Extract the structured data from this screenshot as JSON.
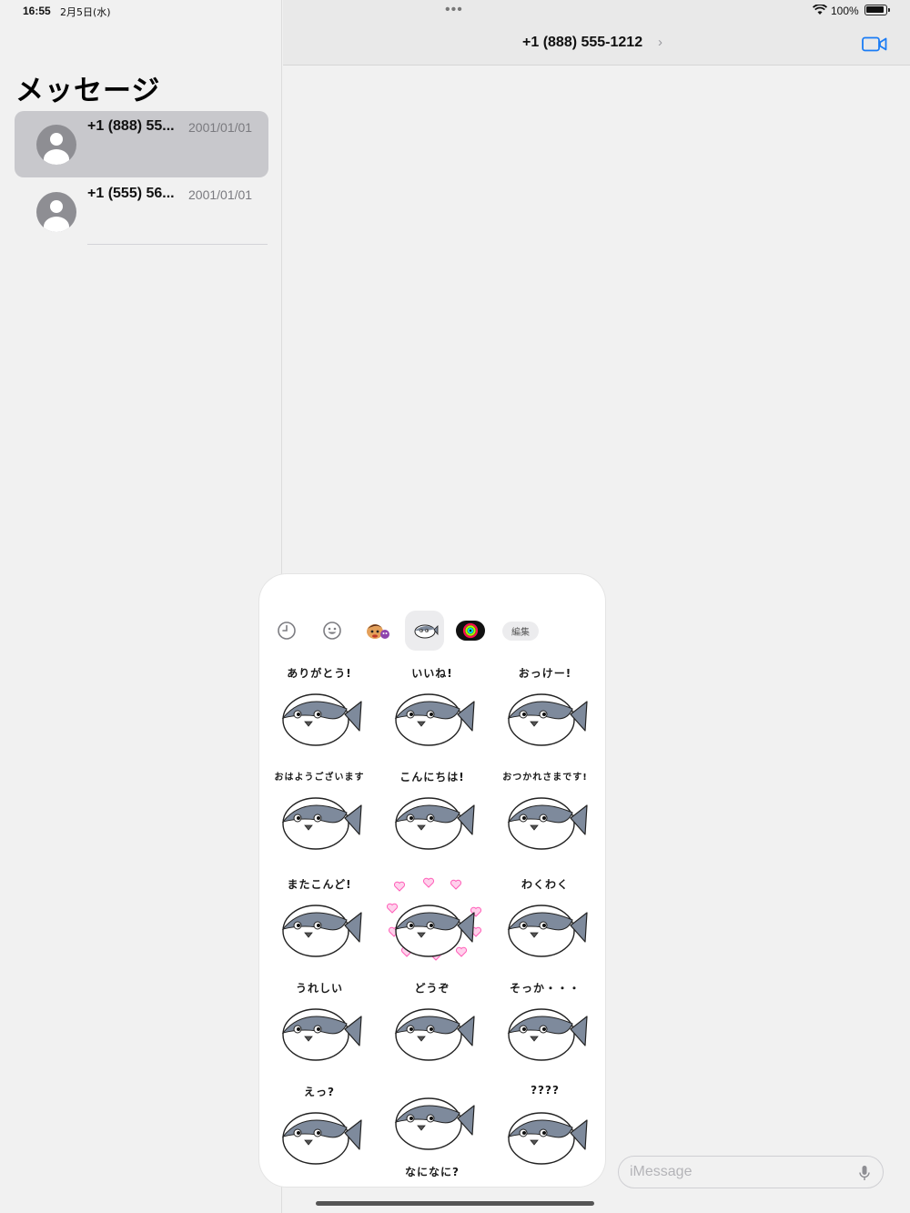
{
  "status": {
    "time": "16:55",
    "date": "2月5日(水)",
    "battery": "100%"
  },
  "sidebar": {
    "title": "メッセージ",
    "conversations": [
      {
        "name": "+1 (888) 55...",
        "date": "2001/01/01"
      },
      {
        "name": "+1 (555) 56...",
        "date": "2001/01/01"
      }
    ]
  },
  "chat": {
    "contact": "+1 (888) 555-1212",
    "chevron": "›",
    "more": "•••"
  },
  "sticker_panel": {
    "tabs": [
      "recent-icon",
      "emoji-icon",
      "memoji-icon",
      "fish-sticker-pack-icon",
      "activity-rings-icon"
    ],
    "edit_label": "編集",
    "stickers": [
      "ありがとう!",
      "いいね!",
      "おっけー!",
      "おはようございます",
      "こんにちは!",
      "おつかれさまです!",
      "またこんど!",
      "",
      "わくわく",
      "うれしい",
      "どうぞ",
      "そっか・・・",
      "えっ?",
      "なになに?",
      "????"
    ]
  },
  "compose": {
    "placeholder": "iMessage"
  },
  "colors": {
    "accent": "#1a7cf5",
    "fish_back": "#7e8a9c",
    "fish_belly": "#ffffff",
    "selected_row": "#c8c8cc"
  }
}
